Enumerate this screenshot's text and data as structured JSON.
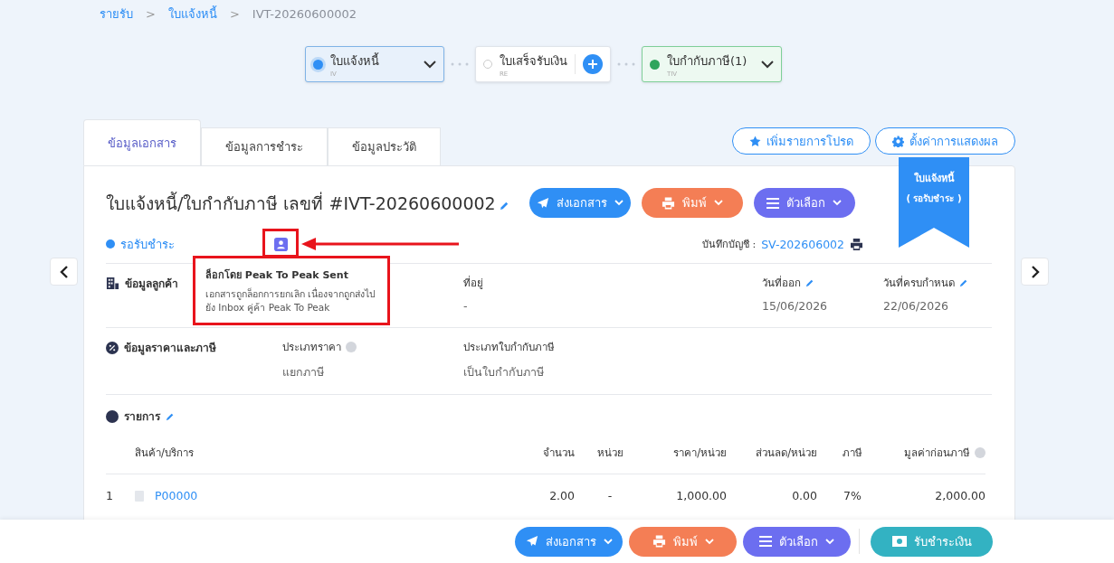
{
  "breadcrumb": [
    {
      "label": "รายรับ",
      "link": true
    },
    {
      "label": "ใบแจ้งหนี้",
      "link": true
    },
    {
      "label": "IVT-20260600002",
      "link": false
    }
  ],
  "breadcrumb_separator": ">",
  "flow": [
    {
      "label": "ใบแจ้งหนี้",
      "code": "IV",
      "selected": true,
      "color": "#2f8ff5",
      "kind": "dropdown"
    },
    {
      "label": "ใบเสร็จรับเงิน",
      "code": "RE",
      "selected": false,
      "kind": "add"
    },
    {
      "label": "ใบกำกับภาษี",
      "count": "(1)",
      "code": "TIV",
      "selected": false,
      "color": "#2fa55c",
      "kind": "dropdown"
    }
  ],
  "tabs": [
    {
      "label": "ข้อมูลเอกสาร",
      "selected": true
    },
    {
      "label": "ข้อมูลการชำระ",
      "selected": false
    },
    {
      "label": "ข้อมูลประวัติ",
      "selected": false
    }
  ],
  "top_actions": [
    {
      "label": "เพิ่มรายการโปรด"
    },
    {
      "label": "ตั้งค่าการแสดงผล"
    }
  ],
  "title": "ใบแจ้งหนี้/ใบกำกับภาษี เลขที่ #IVT-20260600002",
  "status": {
    "label": "รอรับชำระ",
    "color": "#2f8ff5",
    "locked": true
  },
  "actions": [
    {
      "label": "ส่งเอกสาร",
      "color": "#2f8ff5"
    },
    {
      "label": "พิมพ์",
      "color": "#f47e55"
    },
    {
      "label": "ตัวเลือก",
      "color": "#6c6ef0"
    }
  ],
  "journal": {
    "label": "บันทึกบัญชี :",
    "value": "SV-202606002"
  },
  "ribbon": {
    "title": "ใบแจ้งหนี้",
    "subtitle": "( รอรับชำระ )"
  },
  "tooltip": {
    "title": "ล็อกโดย Peak To Peak Sent",
    "text": "เอกสารถูกล็อกการยกเลิก เนื่องจากถูกส่งไปยัง Inbox คู่ค้า Peak To Peak"
  },
  "sections": [
    {
      "title": "ข้อมูลลูกค้า",
      "fields": [
        {
          "label": "ที่อยู่",
          "value": "-"
        },
        {
          "label": "วันที่ออก",
          "value": "15/06/2026",
          "editable": true
        },
        {
          "label": "วันที่ครบกำหนด",
          "value": "22/06/2026",
          "editable": true
        }
      ]
    },
    {
      "title": "ข้อมูลราคาและภาษี",
      "fields": [
        {
          "label": "ประเภทราคา",
          "value": "แยกภาษี",
          "help": true
        },
        {
          "label": "ประเภทใบกำกับภาษี",
          "value": "เป็นใบกำกับภาษี"
        }
      ]
    }
  ],
  "items": {
    "title": "รายการ",
    "columns": [
      {
        "label": "สินค้า/บริการ"
      },
      {
        "label": "จำนวน"
      },
      {
        "label": "หน่วย"
      },
      {
        "label": "ราคา/หน่วย"
      },
      {
        "label": "ส่วนลด/หน่วย"
      },
      {
        "label": "ภาษี"
      },
      {
        "label": "มูลค่าก่อนภาษี",
        "help": true
      }
    ],
    "rows": [
      {
        "index": "1",
        "cells": [
          "P00000",
          "2.00",
          "-",
          "1,000.00",
          "0.00",
          "7%",
          "2,000.00"
        ]
      }
    ]
  },
  "bottom_actions": [
    {
      "label": "ส่งเอกสาร",
      "color": "#2f8ff5",
      "menu": true
    },
    {
      "label": "พิมพ์",
      "color": "#f47e55",
      "menu": true
    },
    {
      "label": "ตัวเลือก",
      "color": "#6c6ef0",
      "menu": true
    },
    {
      "label": "รับชำระเงิน",
      "color": "#33b2c2",
      "menu": false
    }
  ]
}
